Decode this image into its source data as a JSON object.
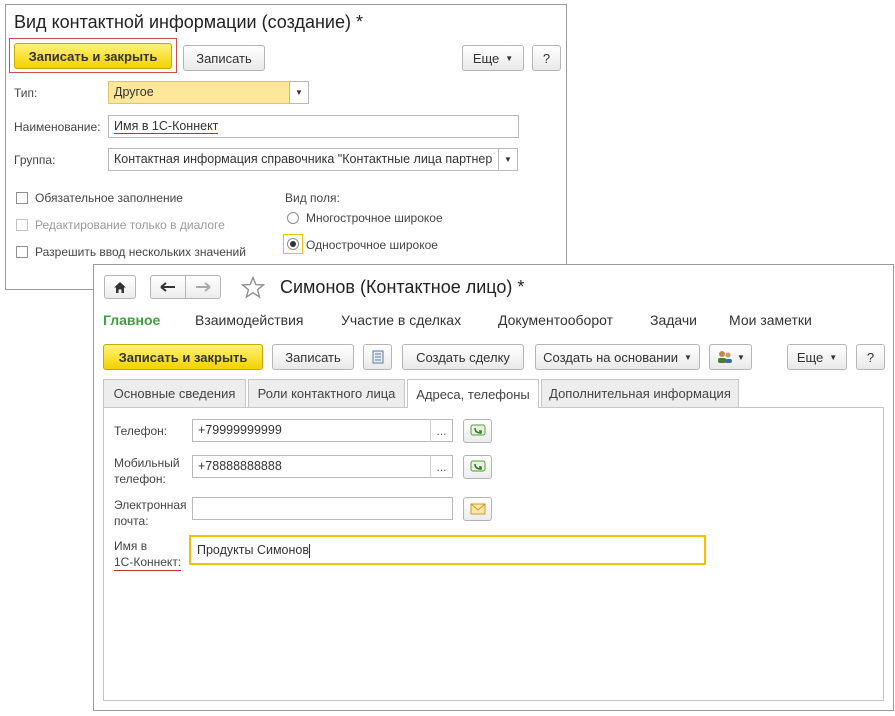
{
  "back_window": {
    "title": "Вид контактной информации (создание) *",
    "toolbar": {
      "save_close": "Записать и закрыть",
      "save": "Записать",
      "more": "Еще",
      "help": "?"
    },
    "fields": {
      "type_label": "Тип:",
      "type_value": "Другое",
      "name_label": "Наименование:",
      "name_value": "Имя в 1С-Коннект",
      "group_label": "Группа:",
      "group_value": "Контактная информация справочника \"Контактные лица партнер"
    },
    "checkboxes": [
      {
        "label": "Обязательное заполнение",
        "checked": false,
        "disabled": false
      },
      {
        "label": "Редактирование только в диалоге",
        "checked": false,
        "disabled": true
      },
      {
        "label": "Разрешить ввод нескольких значений",
        "checked": false,
        "disabled": false
      }
    ],
    "field_kind": {
      "label": "Вид поля:",
      "options": [
        {
          "label": "Многострочное широкое",
          "selected": false
        },
        {
          "label": "Однострочное широкое",
          "selected": true
        }
      ]
    }
  },
  "front_window": {
    "title": "Симонов (Контактное лицо) *",
    "nav": [
      "Главное",
      "Взаимодействия",
      "Участие в сделках",
      "Документооборот",
      "Задачи",
      "Мои заметки"
    ],
    "toolbar": {
      "save_close": "Записать и закрыть",
      "save": "Записать",
      "create_deal": "Создать сделку",
      "create_based": "Создать на основании",
      "more": "Еще",
      "help": "?"
    },
    "tabs": [
      "Основные сведения",
      "Роли контактного лица",
      "Адреса, телефоны",
      "Дополнительная информация"
    ],
    "active_tab": "Адреса, телефоны",
    "fields": {
      "phone_label": "Телефон:",
      "phone_value": "+79999999999",
      "mobile_label_1": "Мобильный",
      "mobile_label_2": "телефон:",
      "mobile_value": "+78888888888",
      "email_label_1": "Электронная",
      "email_label_2": "почта:",
      "email_value": "",
      "connect_label_1": "Имя в",
      "connect_label_2": "1С-Коннект:",
      "connect_value": "Продукты Симонов"
    },
    "colors": {
      "accent_green": "#3f9e3f",
      "yellow_button": "#f2d200",
      "highlight_underline": "#c03030"
    }
  }
}
